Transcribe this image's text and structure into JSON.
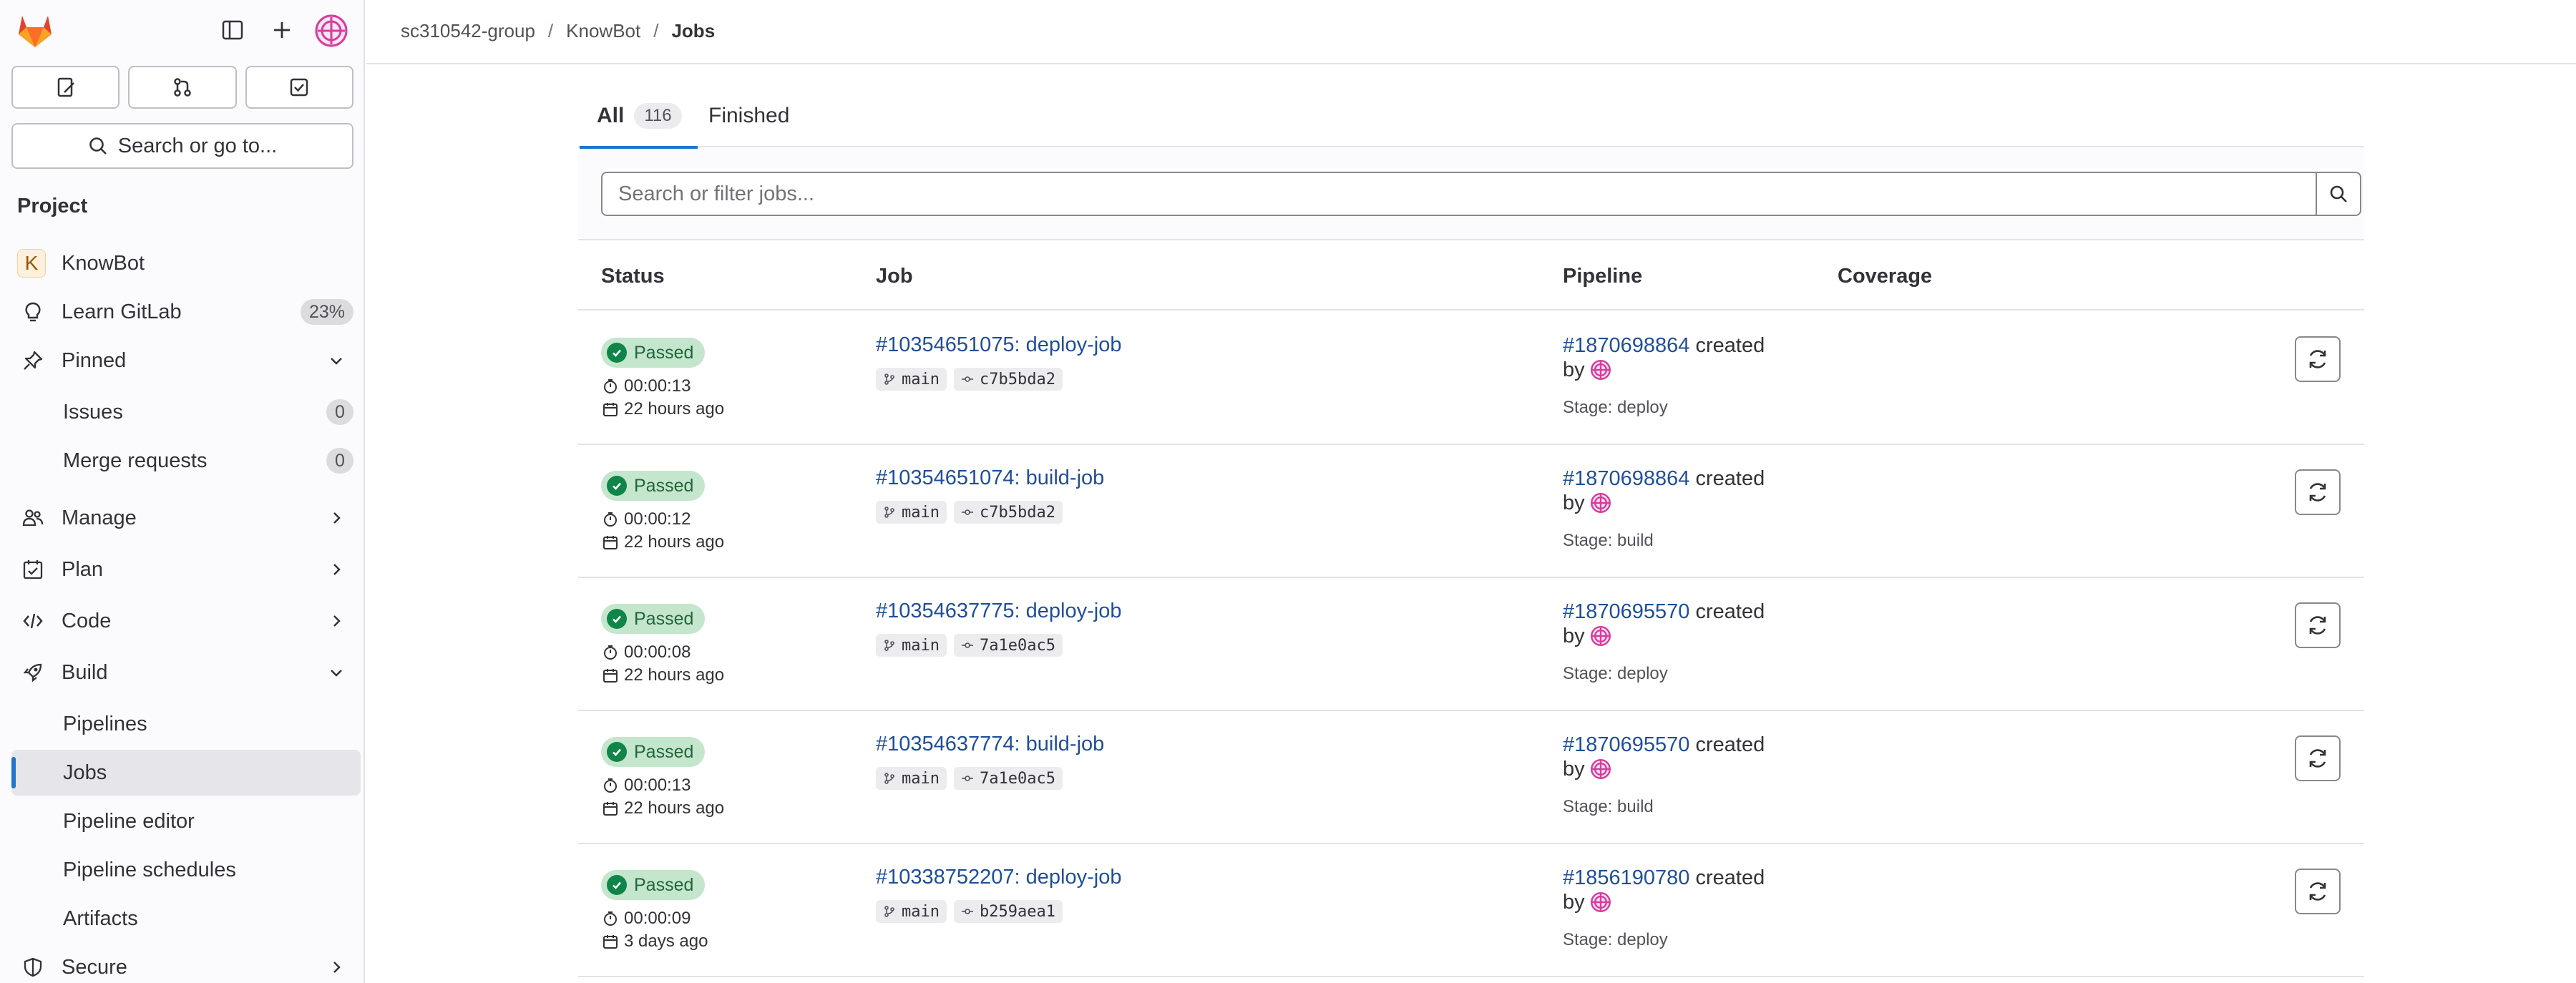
{
  "sidebar": {
    "search_label": "Search or go to...",
    "section_title": "Project",
    "project_initial": "K",
    "project_name": "KnowBot",
    "learn_label": "Learn GitLab",
    "learn_progress": "23%",
    "pinned_label": "Pinned",
    "issues_label": "Issues",
    "issues_count": "0",
    "mr_label": "Merge requests",
    "mr_count": "0",
    "manage_label": "Manage",
    "plan_label": "Plan",
    "code_label": "Code",
    "build_label": "Build",
    "pipelines_label": "Pipelines",
    "jobs_label": "Jobs",
    "pipeline_editor_label": "Pipeline editor",
    "pipeline_schedules_label": "Pipeline schedules",
    "artifacts_label": "Artifacts",
    "secure_label": "Secure"
  },
  "breadcrumb": {
    "group": "sc310542-group",
    "project": "KnowBot",
    "current": "Jobs"
  },
  "tabs": {
    "all_label": "All",
    "all_count": "116",
    "finished_label": "Finished"
  },
  "filter": {
    "placeholder": "Search or filter jobs..."
  },
  "table": {
    "headers": {
      "status": "Status",
      "job": "Job",
      "pipeline": "Pipeline",
      "coverage": "Coverage"
    },
    "rows": [
      {
        "status": "Passed",
        "duration": "00:00:13",
        "finished": "22 hours ago",
        "job": "#10354651075: deploy-job",
        "branch": "main",
        "commit": "c7b5bda2",
        "pipeline": "#1870698864",
        "created_text": "created",
        "by_text": "by",
        "stage": "Stage: deploy"
      },
      {
        "status": "Passed",
        "duration": "00:00:12",
        "finished": "22 hours ago",
        "job": "#10354651074: build-job",
        "branch": "main",
        "commit": "c7b5bda2",
        "pipeline": "#1870698864",
        "created_text": "created",
        "by_text": "by",
        "stage": "Stage: build"
      },
      {
        "status": "Passed",
        "duration": "00:00:08",
        "finished": "22 hours ago",
        "job": "#10354637775: deploy-job",
        "branch": "main",
        "commit": "7a1e0ac5",
        "pipeline": "#1870695570",
        "created_text": "created",
        "by_text": "by",
        "stage": "Stage: deploy"
      },
      {
        "status": "Passed",
        "duration": "00:00:13",
        "finished": "22 hours ago",
        "job": "#10354637774: build-job",
        "branch": "main",
        "commit": "7a1e0ac5",
        "pipeline": "#1870695570",
        "created_text": "created",
        "by_text": "by",
        "stage": "Stage: build"
      },
      {
        "status": "Passed",
        "duration": "00:00:09",
        "finished": "3 days ago",
        "job": "#10338752207: deploy-job",
        "branch": "main",
        "commit": "b259aea1",
        "pipeline": "#1856190780",
        "created_text": "created",
        "by_text": "by",
        "stage": "Stage: deploy"
      }
    ]
  },
  "colors": {
    "accent": "#1f75cb",
    "link": "#1f4e9a",
    "success": "#108548",
    "success_bg": "#c3e6cd"
  }
}
